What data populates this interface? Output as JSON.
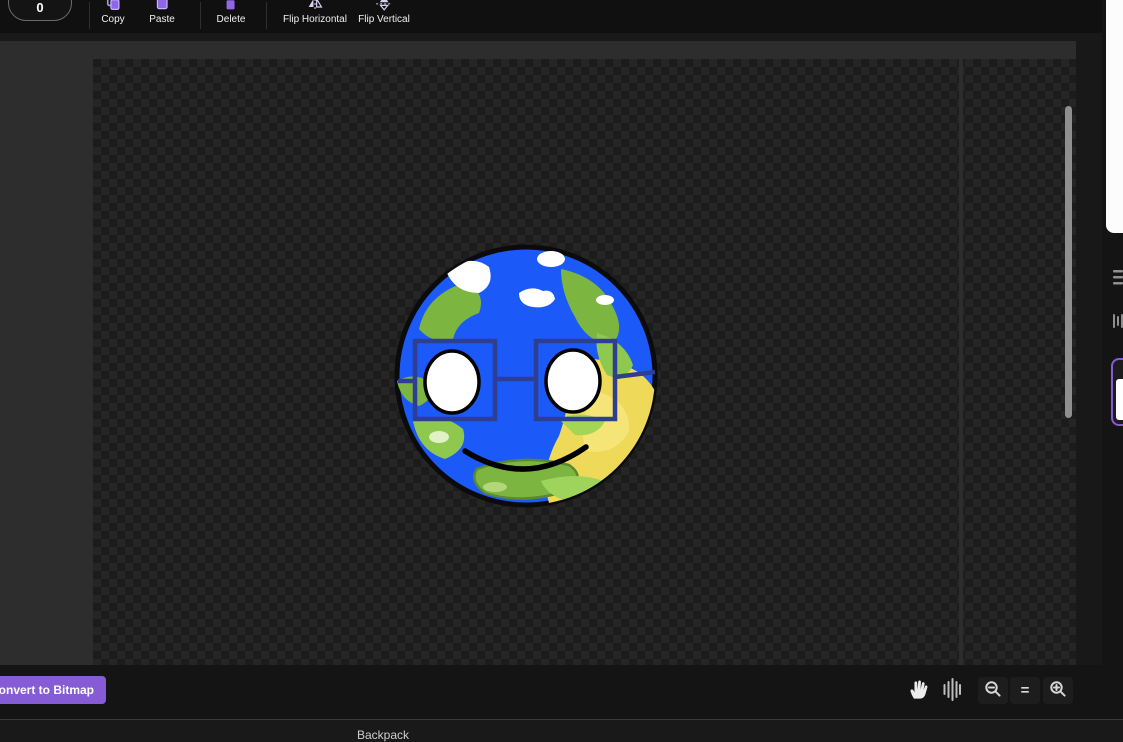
{
  "toolbar": {
    "stepper_value": "0",
    "copy_label": "Copy",
    "paste_label": "Paste",
    "delete_label": "Delete",
    "flip_horizontal_label": "Flip Horizontal",
    "flip_vertical_label": "Flip Vertical"
  },
  "canvas": {
    "artwork": "Earth character with blue square glasses, white oval eyes, green continents, yellow desert region and a black smile on a transparent checkerboard"
  },
  "footer": {
    "convert_button_label": "Convert to Bitmap",
    "zoom_reset_label": "="
  },
  "backpack": {
    "label": "Backpack"
  },
  "colors": {
    "accent_purple": "#855cd6",
    "icon_purple": "#b694f0",
    "ocean_blue": "#1b59f8",
    "land_green": "#7cb640",
    "desert_yellow": "#efd958",
    "glasses_navy": "#2e3e92",
    "checker_dark": "#1c1c1c",
    "checker_light": "#252525"
  }
}
